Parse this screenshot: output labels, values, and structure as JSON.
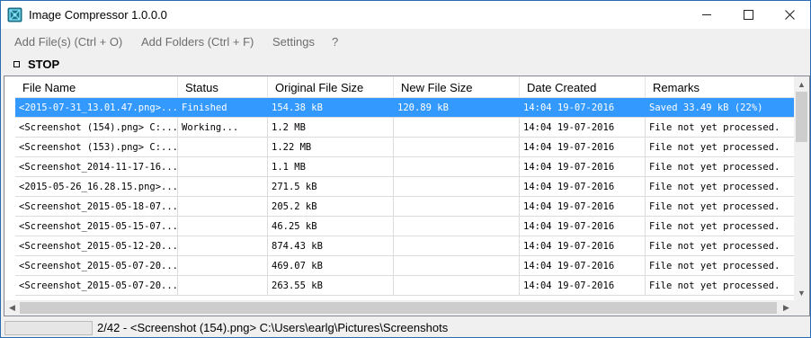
{
  "window": {
    "title": "Image Compressor 1.0.0.0",
    "accent": "#3399ff"
  },
  "menu": {
    "add_files": "Add File(s) (Ctrl + O)",
    "add_folders": "Add Folders (Ctrl + F)",
    "settings": "Settings",
    "help": "?"
  },
  "stop": {
    "label": "STOP"
  },
  "table": {
    "columns": [
      "File Name",
      "Status",
      "Original File Size",
      "New File Size",
      "Date Created",
      "Remarks"
    ],
    "rows": [
      [
        "<2015-07-31_13.01.47.png>...",
        "Finished",
        "154.38 kB",
        "120.89 kB",
        "14:04 19-07-2016",
        "Saved 33.49 kB (22%)"
      ],
      [
        "<Screenshot (154).png> C:...",
        "Working...",
        "1.2 MB",
        "",
        "14:04 19-07-2016",
        "File not yet processed."
      ],
      [
        "<Screenshot (153).png> C:...",
        "",
        "1.22 MB",
        "",
        "14:04 19-07-2016",
        "File not yet processed."
      ],
      [
        "<Screenshot_2014-11-17-16...",
        "",
        "1.1 MB",
        "",
        "14:04 19-07-2016",
        "File not yet processed."
      ],
      [
        "<2015-05-26_16.28.15.png>...",
        "",
        "271.5 kB",
        "",
        "14:04 19-07-2016",
        "File not yet processed."
      ],
      [
        "<Screenshot_2015-05-18-07...",
        "",
        "205.2 kB",
        "",
        "14:04 19-07-2016",
        "File not yet processed."
      ],
      [
        "<Screenshot_2015-05-15-07...",
        "",
        "46.25 kB",
        "",
        "14:04 19-07-2016",
        "File not yet processed."
      ],
      [
        "<Screenshot_2015-05-12-20...",
        "",
        "874.43 kB",
        "",
        "14:04 19-07-2016",
        "File not yet processed."
      ],
      [
        "<Screenshot_2015-05-07-20...",
        "",
        "469.07 kB",
        "",
        "14:04 19-07-2016",
        "File not yet processed."
      ],
      [
        "<Screenshot_2015-05-07-20...",
        "",
        "263.55 kB",
        "",
        "14:04 19-07-2016",
        "File not yet processed."
      ]
    ],
    "selected_row": 0
  },
  "status": {
    "progress_fraction": 0.0,
    "text": "2/42 - <Screenshot (154).png> C:\\Users\\earlg\\Pictures\\Screenshots"
  }
}
